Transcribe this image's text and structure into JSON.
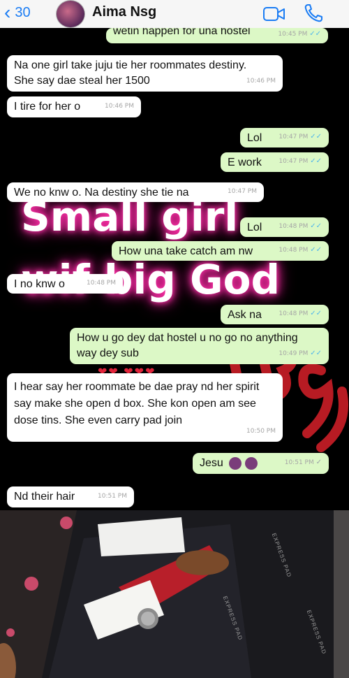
{
  "header": {
    "back_count": "30",
    "contact_name": "Aima Nsg"
  },
  "messages": [
    {
      "dir": "out",
      "text": "wetin happen for una hostel",
      "time": "10:45 PM"
    },
    {
      "dir": "in",
      "text": "Na one girl take juju tie her roommates destiny. She say dae steal her 1500",
      "time": "10:46 PM"
    },
    {
      "dir": "in",
      "text": "I tire for her o",
      "time": "10:46 PM"
    },
    {
      "dir": "out",
      "text": "Lol",
      "time": "10:47 PM"
    },
    {
      "dir": "out",
      "text": "E work",
      "time": "10:47 PM"
    },
    {
      "dir": "in",
      "text": "We no knw o. Na destiny she tie na",
      "time": "10:47 PM"
    },
    {
      "dir": "out",
      "text": "Lol",
      "time": "10:48 PM"
    },
    {
      "dir": "out",
      "text": "How una take catch am nw",
      "time": "10:48 PM"
    },
    {
      "dir": "in",
      "text": "I no knw o",
      "time": "10:48 PM"
    },
    {
      "dir": "out",
      "text": "Ask na",
      "time": "10:48 PM"
    },
    {
      "dir": "out",
      "text": "How u go dey dat hostel u no go no anything way dey sub",
      "time": "10:49 PM"
    },
    {
      "dir": "in",
      "text": "I hear say her roommate be dae pray nd her spirit say make she open d box. She kon open am see dose tins. She even carry pad join",
      "time": "10:50 PM"
    },
    {
      "dir": "out",
      "text": "Jesu",
      "time": "10:51 PM"
    },
    {
      "dir": "in",
      "text": "Nd their hair",
      "time": "10:51 PM"
    }
  ],
  "overlay": {
    "line1": "Small girl",
    "line2": "wif big God",
    "mark": "IB9J"
  },
  "photo": {
    "bag_text": "EXPRESS PAD"
  },
  "colors": {
    "accent": "#1a7cf4",
    "outgoing": "#dcf8c6",
    "incoming": "#ffffff",
    "glow": "#ff2fa8"
  }
}
